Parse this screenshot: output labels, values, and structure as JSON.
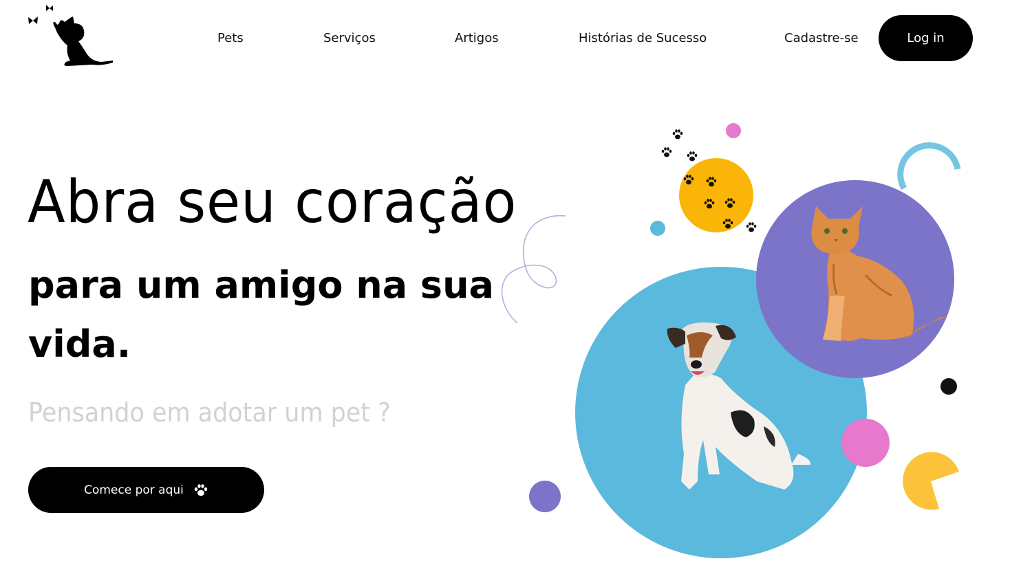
{
  "brand": {
    "logo_icon": "cat-with-butterflies-icon"
  },
  "nav": {
    "items": [
      {
        "label": "Pets"
      },
      {
        "label": "Serviços"
      },
      {
        "label": "Artigos"
      },
      {
        "label": "Histórias de Sucesso"
      },
      {
        "label": "Cadastre-se"
      }
    ],
    "login_label": "Log in"
  },
  "hero": {
    "title": "Abra seu coração",
    "subtitle": "para um amigo na sua vida.",
    "question": "Pensando em adotar um pet ?",
    "cta_label": "Comece por aqui",
    "cta_icon": "paw-icon"
  },
  "illustration": {
    "icons": [
      "dog-image",
      "cat-image",
      "paw-prints-icon"
    ],
    "colors": {
      "blue": "#5ab9dc",
      "purple": "#7c74c8",
      "yellow": "#fbb508",
      "pink": "#e679cc",
      "gold": "#fcc33a",
      "black": "#111111"
    }
  }
}
